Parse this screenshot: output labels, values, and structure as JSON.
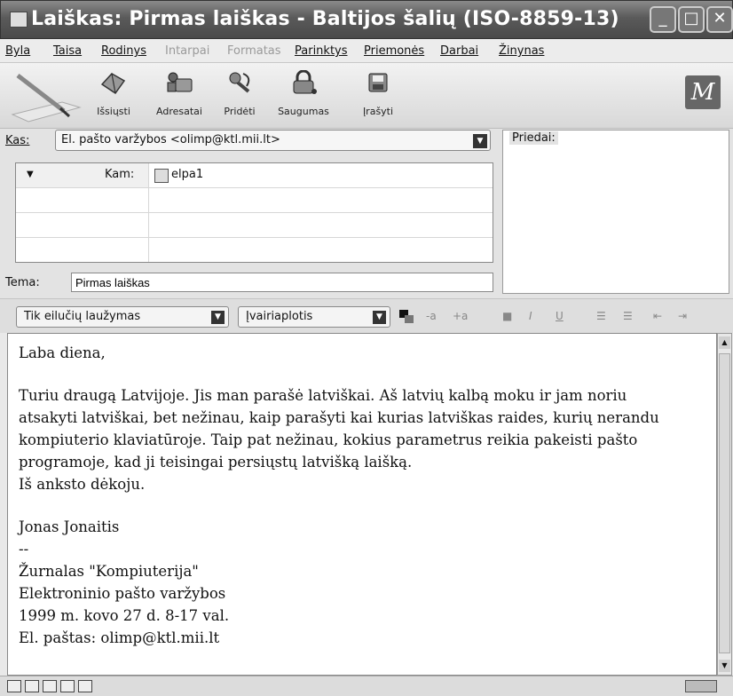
{
  "window": {
    "title": "Laiškas: Pirmas laiškas - Baltijos šalių (ISO-8859-13)",
    "controls": [
      "_",
      "□",
      "✕"
    ]
  },
  "menu": [
    {
      "label": "Byla",
      "enabled": true
    },
    {
      "label": "Taisa",
      "enabled": true
    },
    {
      "label": "Rodinys",
      "enabled": true
    },
    {
      "label": "Intarpai",
      "enabled": false
    },
    {
      "label": "Formatas",
      "enabled": false
    },
    {
      "label": "Parinktys",
      "enabled": true
    },
    {
      "label": "Priemonės",
      "enabled": true
    },
    {
      "label": "Darbai",
      "enabled": true
    },
    {
      "label": "Žinynas",
      "enabled": true
    }
  ],
  "toolbar": {
    "buttons": [
      {
        "label": "Išsiųsti",
        "icon": "send-icon"
      },
      {
        "label": "Adresatai",
        "icon": "address-book-icon"
      },
      {
        "label": "Pridėti",
        "icon": "attach-icon"
      },
      {
        "label": "Saugumas",
        "icon": "security-lock-icon"
      },
      {
        "label": "Įrašyti",
        "icon": "save-icon"
      }
    ]
  },
  "header": {
    "from_label": "Kas:",
    "from_value": "El. pašto varžybos <olimp@ktl.mii.lt>",
    "to_label": "Kam:",
    "to_value": "elpa1",
    "attachments_label": "Priedai:",
    "subject_label": "Tema:",
    "subject_value": "Pirmas laiškas"
  },
  "format": {
    "paragraph_style": "Tik eilučių laužymas",
    "font": "Įvairiaplotis"
  },
  "body": {
    "lines": [
      "Laba diena,",
      "",
      "Turiu draugą Latvijoje. Jis man parašė latviškai. Aš latvių kalbą moku ir jam noriu",
      "atsakyti latviškai, bet nežinau, kaip parašyti kai kurias latviškas raides, kurių nerandu",
      "kompiuterio klaviatūroje. Taip pat nežinau, kokius parametrus reikia pakeisti pašto",
      "programoje, kad ji teisingai persiųstų latvišką laišką.",
      "Iš anksto dėkoju.",
      "",
      "Jonas Jonaitis",
      "--",
      "Žurnalas \"Kompiuterija\"",
      "Elektroninio pašto varžybos",
      "1999 m. kovo 27 d. 8-17 val.",
      "El. paštas: olimp@ktl.mii.lt"
    ]
  }
}
